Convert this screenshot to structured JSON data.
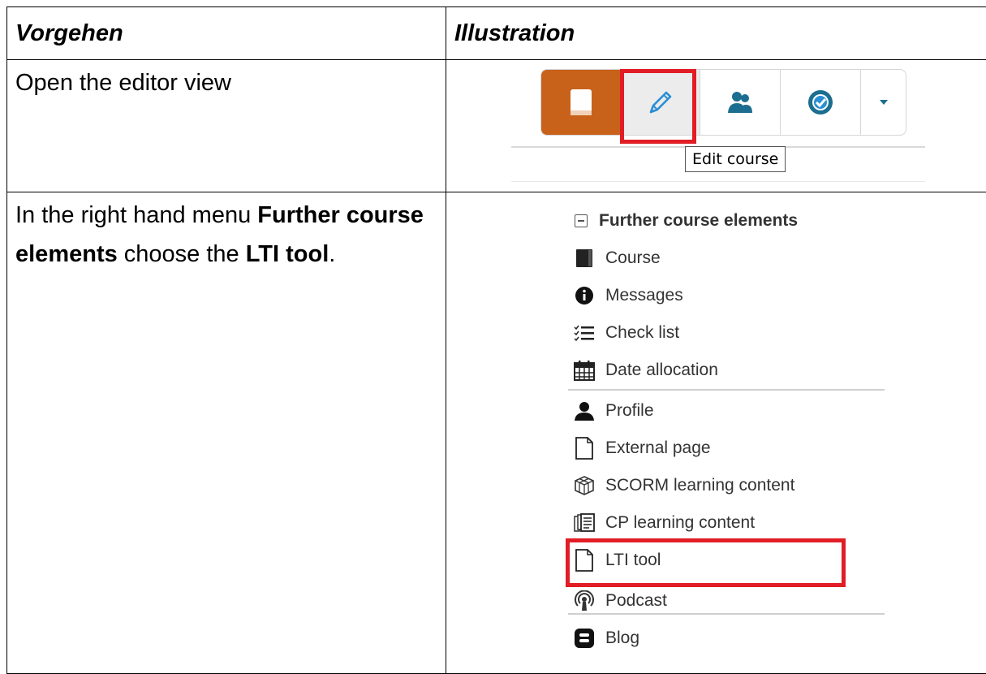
{
  "table": {
    "header": {
      "col1": "Vorgehen",
      "col2": "Illustration"
    },
    "rows": [
      {
        "step": "Open the editor view"
      },
      {
        "step_parts": [
          "In the right hand menu ",
          "Further course elements",
          " choose the ",
          "LTI tool",
          "."
        ]
      }
    ]
  },
  "toolbar": {
    "tooltip": "Edit course",
    "buttons": [
      "course-icon",
      "pencil-icon",
      "members-icon",
      "assessment-icon",
      "caret-down-icon"
    ],
    "colors": {
      "course_bg": "#c8621a",
      "highlight": "#e11d25",
      "icon_blue": "#2a8fd4",
      "icon_dark": "#1b6e8f"
    }
  },
  "menu": {
    "heading": "Further course elements",
    "items": [
      {
        "label": "Course",
        "icon": "book-icon"
      },
      {
        "label": "Messages",
        "icon": "info-icon"
      },
      {
        "label": "Check list",
        "icon": "checklist-icon"
      },
      {
        "label": "Date allocation",
        "icon": "calendar-icon"
      },
      {
        "label": "Profile",
        "icon": "person-icon"
      },
      {
        "label": "External page",
        "icon": "page-icon"
      },
      {
        "label": "SCORM learning content",
        "icon": "cube-icon"
      },
      {
        "label": "CP learning content",
        "icon": "pages-icon"
      },
      {
        "label": "LTI tool",
        "icon": "page-icon"
      },
      {
        "label": "Podcast",
        "icon": "podcast-icon"
      },
      {
        "label": "Blog",
        "icon": "blog-icon"
      }
    ]
  }
}
